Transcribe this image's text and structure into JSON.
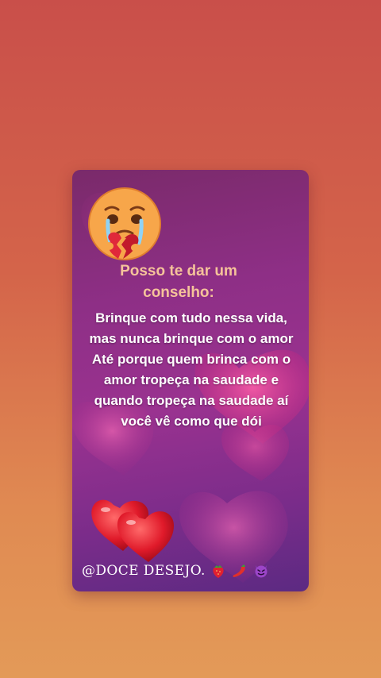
{
  "card": {
    "title": "Posso te dar um conselho:",
    "message": "Brinque com tudo nessa vida, mas nunca brinque com o amor Até porque quem brinca com o amor tropeça na saudade e quando tropeça na saudade aí você vê como que dói"
  },
  "footer": {
    "handle": "@DOCE DESEJO.",
    "icons": [
      "strawberry-icon",
      "chili-pepper-icon",
      "devil-face-icon"
    ]
  },
  "colors": {
    "background_top": "#c94f4a",
    "background_bottom": "#e39a58",
    "title_color": "#f5c39a",
    "card_purple": "#8e2f86"
  }
}
